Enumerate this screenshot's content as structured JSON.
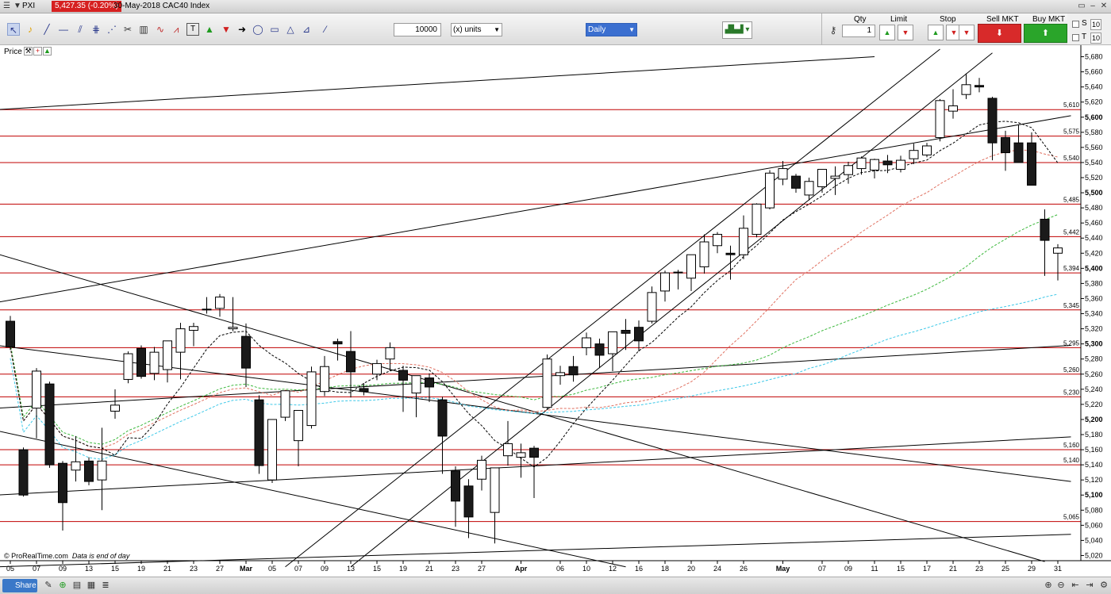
{
  "window": {
    "symbol": "PXI",
    "quote": "5,427.35 (-0.20%)",
    "title": "30-May-2018 CAC40 Index"
  },
  "toolbar": {
    "quantity": "10000",
    "units": "(x) units",
    "period": "Daily",
    "icons": [
      "cursor-icon",
      "bell-icon",
      "trendline-icon",
      "horizontal-line-icon",
      "channel-icon",
      "fibonacci-icon",
      "gann-icon",
      "trash-icon",
      "pattern-icon",
      "wave-icon",
      "text-icon",
      "up-arrow-icon",
      "down-arrow-icon",
      "right-arrow-icon",
      "ellipse-icon",
      "rectangle-icon",
      "triangle-icon",
      "fan-icon",
      "brush-icon",
      "pen-icon"
    ]
  },
  "trade": {
    "qty_label": "Qty",
    "qty_value": "1",
    "limit_label": "Limit",
    "stop_label": "Stop",
    "sell_label": "Sell MKT",
    "buy_label": "Buy MKT",
    "s_label": "S",
    "t_label": "T",
    "s_value": "10",
    "t_value": "10"
  },
  "chart_panel": {
    "label": "Price",
    "credit": "© ProRealTime.com",
    "note": "Data is end of day"
  },
  "statusbar": {
    "share_label": "Share"
  },
  "colors": {
    "bull": "#ffffff",
    "bear": "#1a1a1a",
    "resistance": "#c00000",
    "ma_short": "#000000",
    "ma_mid": "#e07060",
    "ma_long": "#3cb83c",
    "ma_longest": "#3cc8e8"
  },
  "chart_data": {
    "type": "candlestick",
    "ylim": [
      5010,
      5690
    ],
    "y_ticks": [
      5020,
      5040,
      5060,
      5080,
      5100,
      5120,
      5140,
      5160,
      5180,
      5200,
      5220,
      5240,
      5260,
      5280,
      5300,
      5320,
      5340,
      5360,
      5380,
      5400,
      5420,
      5440,
      5460,
      5480,
      5500,
      5520,
      5540,
      5560,
      5580,
      5600,
      5620,
      5640,
      5660,
      5680
    ],
    "y_tick_labels": [
      "5,020",
      "5,040",
      "5,060",
      "5,080",
      "5,100",
      "5,120",
      "5,140",
      "5,160",
      "5,180",
      "5,200",
      "5,220",
      "5,240",
      "5,260",
      "5,280",
      "5,300",
      "5,320",
      "5,340",
      "5,360",
      "5,380",
      "5,400",
      "5,420",
      "5,440",
      "5,460",
      "5,480",
      "5,500",
      "5,520",
      "5,540",
      "5,560",
      "5,580",
      "5,600",
      "5,620",
      "5,640",
      "5,660",
      "5,680"
    ],
    "x_labels": [
      {
        "i": 0,
        "label": "05"
      },
      {
        "i": 2,
        "label": "07"
      },
      {
        "i": 4,
        "label": "09"
      },
      {
        "i": 6,
        "label": "13"
      },
      {
        "i": 8,
        "label": "15"
      },
      {
        "i": 10,
        "label": "19"
      },
      {
        "i": 12,
        "label": "21"
      },
      {
        "i": 14,
        "label": "23"
      },
      {
        "i": 16,
        "label": "27"
      },
      {
        "i": 18,
        "label": "Mar"
      },
      {
        "i": 20,
        "label": "05"
      },
      {
        "i": 22,
        "label": "07"
      },
      {
        "i": 24,
        "label": "09"
      },
      {
        "i": 26,
        "label": "13"
      },
      {
        "i": 28,
        "label": "15"
      },
      {
        "i": 30,
        "label": "19"
      },
      {
        "i": 32,
        "label": "21"
      },
      {
        "i": 34,
        "label": "23"
      },
      {
        "i": 36,
        "label": "27"
      },
      {
        "i": 39,
        "label": "Apr"
      },
      {
        "i": 42,
        "label": "06"
      },
      {
        "i": 44,
        "label": "10"
      },
      {
        "i": 46,
        "label": "12"
      },
      {
        "i": 48,
        "label": "16"
      },
      {
        "i": 50,
        "label": "18"
      },
      {
        "i": 52,
        "label": "20"
      },
      {
        "i": 54,
        "label": "24"
      },
      {
        "i": 56,
        "label": "26"
      },
      {
        "i": 59,
        "label": "May"
      },
      {
        "i": 62,
        "label": "07"
      },
      {
        "i": 64,
        "label": "09"
      },
      {
        "i": 66,
        "label": "11"
      },
      {
        "i": 68,
        "label": "15"
      },
      {
        "i": 70,
        "label": "17"
      },
      {
        "i": 72,
        "label": "21"
      },
      {
        "i": 74,
        "label": "23"
      },
      {
        "i": 76,
        "label": "25"
      },
      {
        "i": 78,
        "label": "29"
      },
      {
        "i": 80,
        "label": "31"
      }
    ],
    "candles": [
      [
        5330,
        5337,
        5292,
        5296
      ],
      [
        5160,
        5163,
        5098,
        5100
      ],
      [
        5215,
        5268,
        5175,
        5264
      ],
      [
        5247,
        5250,
        5136,
        5140
      ],
      [
        5142,
        5145,
        5053,
        5090
      ],
      [
        5133,
        5178,
        5118,
        5144
      ],
      [
        5145,
        5150,
        5113,
        5118
      ],
      [
        5120,
        5189,
        5080,
        5145
      ],
      [
        5211,
        5240,
        5201,
        5219
      ],
      [
        5253,
        5290,
        5248,
        5287
      ],
      [
        5294,
        5298,
        5254,
        5257
      ],
      [
        5261,
        5296,
        5252,
        5289
      ],
      [
        5266,
        5302,
        5249,
        5304
      ],
      [
        5289,
        5328,
        5253,
        5320
      ],
      [
        5318,
        5328,
        5297,
        5323
      ],
      [
        5345,
        5362,
        5340,
        5346
      ],
      [
        5347,
        5366,
        5336,
        5362
      ],
      [
        5320,
        5362,
        5317,
        5322
      ],
      [
        5310,
        5327,
        5243,
        5268
      ],
      [
        5226,
        5232,
        5128,
        5139
      ],
      [
        5120,
        5196,
        5116,
        5200
      ],
      [
        5203,
        5223,
        5198,
        5238
      ],
      [
        5172,
        5212,
        5138,
        5212
      ],
      [
        5192,
        5270,
        5188,
        5263
      ],
      [
        5237,
        5284,
        5231,
        5270
      ],
      [
        5303,
        5307,
        5278,
        5300
      ],
      [
        5290,
        5317,
        5229,
        5263
      ],
      [
        5241,
        5248,
        5232,
        5237
      ],
      [
        5260,
        5279,
        5252,
        5274
      ],
      [
        5280,
        5302,
        5264,
        5295
      ],
      [
        5265,
        5271,
        5210,
        5252
      ],
      [
        5235,
        5248,
        5203,
        5258
      ],
      [
        5255,
        5261,
        5223,
        5243
      ],
      [
        5226,
        5230,
        5128,
        5178
      ],
      [
        5132,
        5138,
        5058,
        5092
      ],
      [
        5112,
        5121,
        5043,
        5071
      ],
      [
        5121,
        5152,
        5106,
        5146
      ],
      [
        5077,
        5134,
        5036,
        5136
      ],
      [
        5152,
        5198,
        5139,
        5168
      ],
      [
        5150,
        5168,
        5123,
        5156
      ],
      [
        5162,
        5165,
        5096,
        5150
      ],
      [
        5216,
        5286,
        5214,
        5280
      ],
      [
        5258,
        5271,
        5246,
        5262
      ],
      [
        5270,
        5284,
        5250,
        5259
      ],
      [
        5295,
        5315,
        5285,
        5308
      ],
      [
        5300,
        5307,
        5268,
        5285
      ],
      [
        5287,
        5315,
        5264,
        5316
      ],
      [
        5318,
        5333,
        5292,
        5314
      ],
      [
        5322,
        5331,
        5290,
        5304
      ],
      [
        5330,
        5376,
        5327,
        5368
      ],
      [
        5370,
        5397,
        5356,
        5394
      ],
      [
        5395,
        5398,
        5372,
        5394
      ],
      [
        5387,
        5412,
        5370,
        5418
      ],
      [
        5402,
        5445,
        5393,
        5435
      ],
      [
        5430,
        5448,
        5420,
        5445
      ],
      [
        5420,
        5430,
        5385,
        5418
      ],
      [
        5418,
        5470,
        5412,
        5453
      ],
      [
        5445,
        5486,
        5441,
        5485
      ],
      [
        5480,
        5530,
        5478,
        5526
      ],
      [
        5518,
        5542,
        5510,
        5532
      ],
      [
        5522,
        5525,
        5500,
        5506
      ],
      [
        5497,
        5520,
        5490,
        5515
      ],
      [
        5508,
        5529,
        5500,
        5531
      ],
      [
        5519,
        5535,
        5497,
        5522
      ],
      [
        5524,
        5541,
        5512,
        5536
      ],
      [
        5532,
        5548,
        5524,
        5546
      ],
      [
        5530,
        5545,
        5519,
        5544
      ],
      [
        5542,
        5550,
        5526,
        5537
      ],
      [
        5531,
        5549,
        5527,
        5543
      ],
      [
        5545,
        5565,
        5538,
        5556
      ],
      [
        5550,
        5566,
        5547,
        5562
      ],
      [
        5573,
        5624,
        5568,
        5622
      ],
      [
        5608,
        5637,
        5598,
        5615
      ],
      [
        5630,
        5658,
        5624,
        5643
      ],
      [
        5642,
        5652,
        5633,
        5640
      ],
      [
        5625,
        5627,
        5543,
        5566
      ],
      [
        5573,
        5582,
        5529,
        5553
      ],
      [
        5566,
        5590,
        5548,
        5540
      ],
      [
        5566,
        5580,
        5519,
        5510
      ],
      [
        5465,
        5478,
        5390,
        5437
      ],
      [
        5420,
        5432,
        5384,
        5427
      ]
    ],
    "horizontal_levels": [
      5610,
      5575,
      5540,
      5485,
      5442,
      5394,
      5345,
      5295,
      5260,
      5230,
      5160,
      5140,
      5065
    ],
    "level_labels": [
      "5,610",
      "5,575",
      "5,540",
      "5,485",
      "5,442",
      "5,394",
      "5,345",
      "5,295",
      "5,260",
      "5,230",
      "5,160",
      "5,140",
      "5,065"
    ],
    "last_price": 5427.35
  }
}
